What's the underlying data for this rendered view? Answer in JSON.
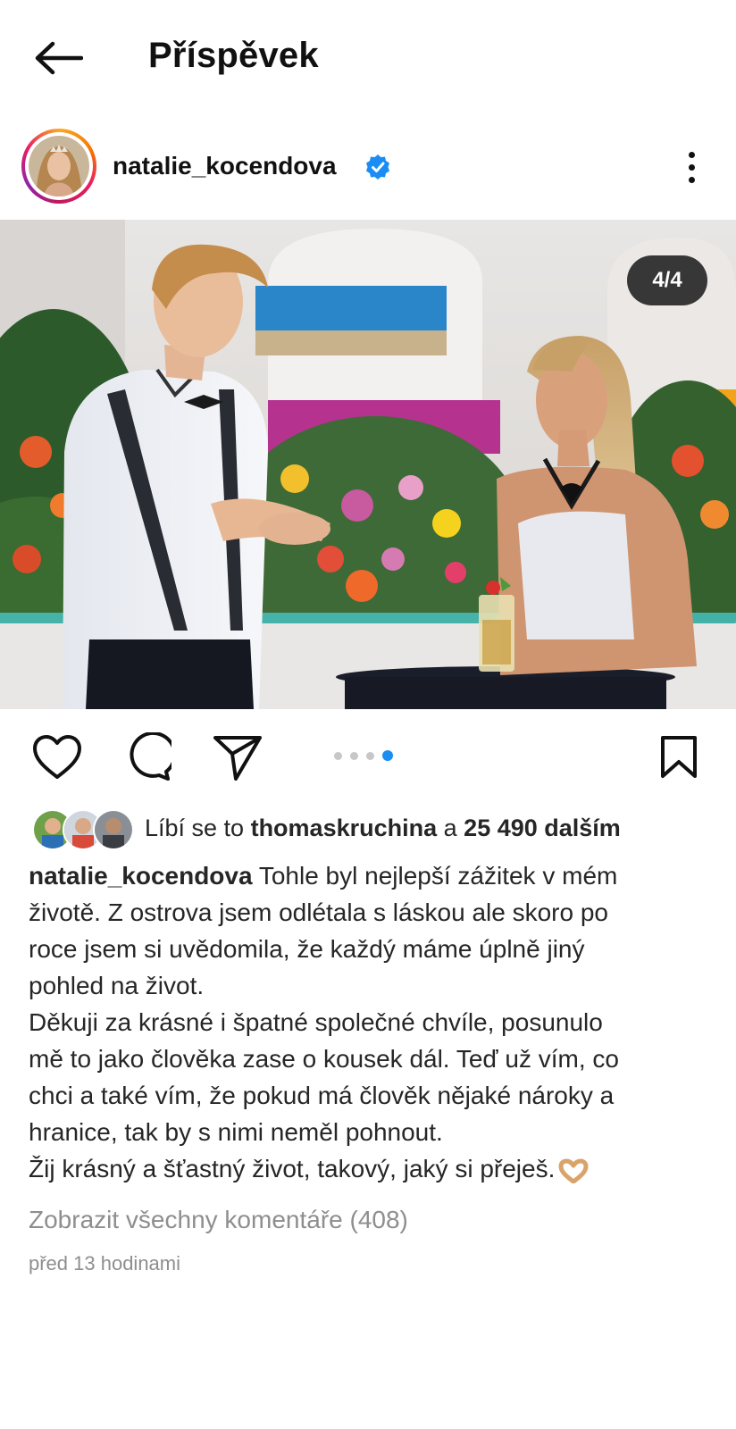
{
  "header": {
    "title": "Příspěvek",
    "back_icon": "arrow-left-icon"
  },
  "post": {
    "username": "natalie_kocendova",
    "verified": true,
    "verified_color": "#1a8df5",
    "more_icon": "more-vertical-icon",
    "media": {
      "counter": "4/4",
      "current_slide": 4,
      "total_slides": 4
    },
    "actions": {
      "like_icon": "heart-icon",
      "comment_icon": "comment-icon",
      "share_icon": "send-icon",
      "save_icon": "bookmark-icon"
    },
    "likes": {
      "prefix": "Líbí se to ",
      "user": "thomaskruchina",
      "middle": " a ",
      "count": "25 490 dalším"
    },
    "caption": {
      "username": "natalie_kocendova",
      "lines": [
        " Tohle byl nejlepší zážitek v mém",
        "životě. Z ostrova jsem odlétala s láskou ale skoro po",
        "roce jsem si uvědomila, že každý máme úplně jiný",
        "pohled na život.",
        "Děkuji za krásné i špatné společné chvíle, posunulo",
        "mě to jako člověka zase o kousek dál. Teď už vím, co",
        "chci a také vím, že pokud má člověk nějaké nároky a",
        "hranice, tak by s nimi neměl pohnout.",
        "Žij krásný a šťastný život, takový, jaký si přeješ."
      ],
      "emoji": "heart-hands-icon"
    },
    "comments_link": "Zobrazit všechny komentáře (408)",
    "timestamp": "před 13 hodinami"
  }
}
